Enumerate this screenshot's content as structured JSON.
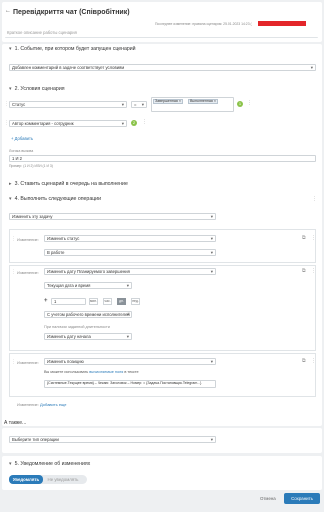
{
  "header": {
    "title": "Перевідкриття чат (Співробітник)",
    "last_modified": "Последнее изменение: правила сценария: 25.01.2023 14:23 ("
  },
  "short_description_placeholder": "Краткое описание работы сценария",
  "section1": {
    "title": "1. Событие, при котором будет запущен сценарий",
    "event_value": "Добавлен комментарий в задаче соответствует условиям"
  },
  "section2": {
    "title": "2. Условия сценария",
    "condition1": {
      "field": "Статус",
      "operator": "=",
      "chips": [
        "Завершенная ×",
        "Выполненная ×"
      ],
      "badge": "1"
    },
    "condition2": {
      "field": "Автор комментария - сотрудник",
      "badge": "2"
    },
    "add_label": "Добавить",
    "logic_label": "Логика вызова",
    "logic_value": "1 И 2",
    "logic_hint": "Пример: (1 И 2) ИЛИ (1 И 3)"
  },
  "section3": {
    "title": "3. Ставить сценарий в очередь на выполнение"
  },
  "section4": {
    "title": "4. Выполнить следующие операции",
    "operation_select": "Изменить эту задачу",
    "change_label": "Изменение:",
    "op_status": {
      "select": "Изменить статус",
      "value": "В работе"
    },
    "op_date": {
      "select": "Изменить дату Планируемого завершения",
      "base": "Текущая дата и время",
      "plus": "+",
      "amount": "1",
      "units": [
        "мин.",
        "час.",
        "дн.",
        "нед."
      ],
      "active_unit": "дн.",
      "mode": "С учетом рабочего времени исполнителей",
      "holiday_label": "При наличии заданной длительности",
      "holiday_value": "Изменить дату начала"
    },
    "op_comment": {
      "select": "Изменить позицию",
      "hint_prefix": "Вы можете использовать ",
      "hint_link": "вычисляемые поля",
      "hint_suffix": " в тексте",
      "text": "{Системные.Текущее время} – Чекаю: Заголовок – Номер: = {Задача.Постановщик.Telegram...}"
    },
    "add_change_prefix": "Изменение:",
    "add_change_link": "Добавить еще"
  },
  "also": {
    "title": "А также...",
    "select": "Выберите тип операции"
  },
  "section5": {
    "title": "5. Уведомление об изменениях",
    "toggle_on": "Уведомлять",
    "toggle_off": "Не уведомлять"
  },
  "footer": {
    "cancel": "Отмена",
    "save": "Сохранить"
  },
  "colors": {
    "accent": "#2b7bb9",
    "badge": "#8bc34a",
    "redacted": "#e3262a"
  }
}
